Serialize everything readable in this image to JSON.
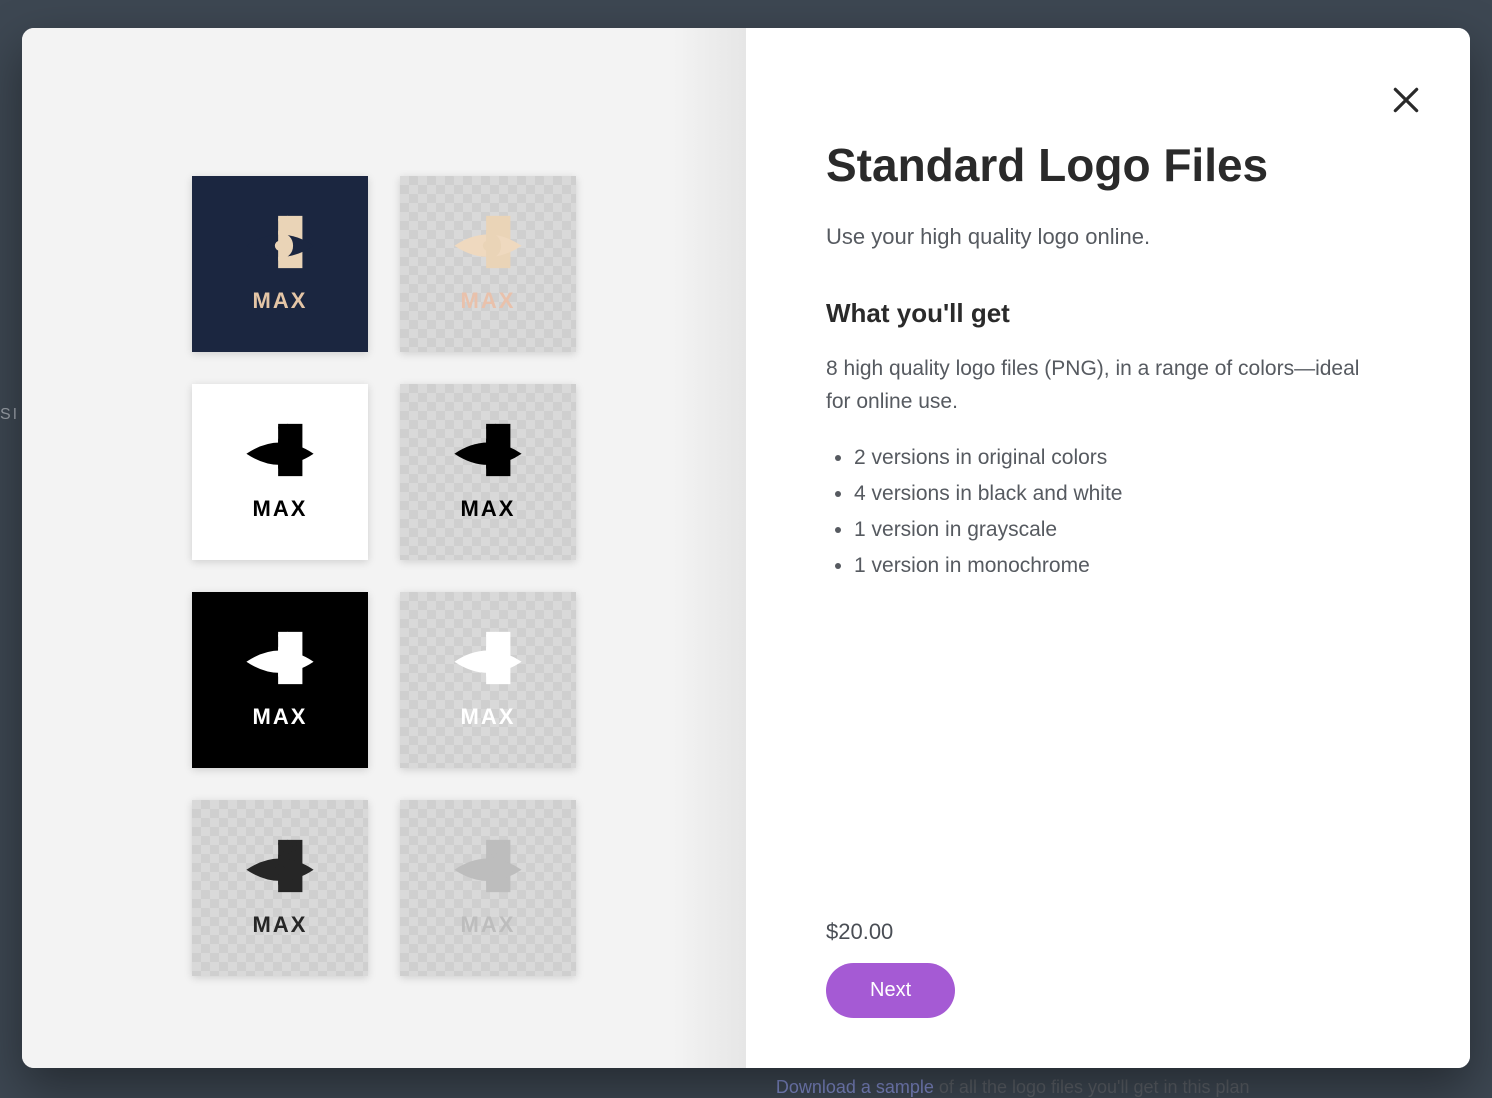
{
  "modal": {
    "title": "Standard Logo Files",
    "subtitle": "Use your high quality logo online.",
    "section_heading": "What you'll get",
    "description": "8 high quality logo files (PNG), in a range of colors—ideal for online use.",
    "bullets": [
      "2 versions in original colors",
      "4 versions in black and white",
      "1 version in grayscale",
      "1 version in monochrome"
    ],
    "price": "$20.00",
    "next_label": "Next"
  },
  "sample": {
    "link_text": "Download a sample",
    "tail_text": " of all the logo files you'll get in this plan"
  },
  "brand_word": "MAX",
  "logo_variants": [
    {
      "name": "original-dark",
      "bg": "navy",
      "rect": "#ead4b7",
      "eye": "#1b2640",
      "lash": "#ead4b7",
      "word": "#e4c5a6"
    },
    {
      "name": "original-light",
      "bg": "checker",
      "rect": "#ead4b7",
      "eye": "#efd9bf",
      "lash": "#ead4b7",
      "word": "#e9c1ab"
    },
    {
      "name": "bw-on-white",
      "bg": "white",
      "rect": "#000000",
      "eye": "#000000",
      "lash": "#000000",
      "word": "#000000"
    },
    {
      "name": "bw-on-transparent",
      "bg": "checker",
      "rect": "#000000",
      "eye": "#000000",
      "lash": "#000000",
      "word": "#000000"
    },
    {
      "name": "bw-on-black",
      "bg": "black",
      "rect": "#ffffff",
      "eye": "#ffffff",
      "lash": "#ffffff",
      "word": "#ffffff"
    },
    {
      "name": "white-on-transparent",
      "bg": "checker",
      "rect": "#ffffff",
      "eye": "#ffffff",
      "lash": "#ffffff",
      "word": "#ffffff"
    },
    {
      "name": "grayscale",
      "bg": "checker",
      "rect": "#262626",
      "eye": "#262626",
      "lash": "#262626",
      "word": "#262626"
    },
    {
      "name": "monochrome",
      "bg": "checker",
      "rect": "#bdbdbd",
      "eye": "#bdbdbd",
      "lash": "#bdbdbd",
      "word": "#bdbdbd"
    }
  ],
  "background_tab_hint": "SI"
}
